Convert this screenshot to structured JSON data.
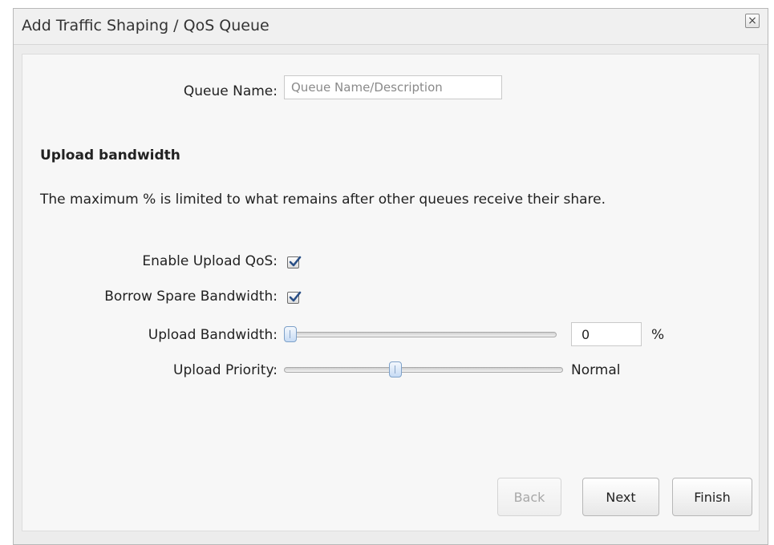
{
  "dialog": {
    "title": "Add Traffic Shaping / QoS Queue",
    "close_glyph": "×",
    "close_icon": "close-icon"
  },
  "queue": {
    "label": "Queue Name:",
    "value": "",
    "placeholder": "Queue Name/Description"
  },
  "upload": {
    "heading": "Upload bandwidth",
    "description": "The maximum % is limited to what remains after other queues receive their share.",
    "enable_qos_label": "Enable Upload QoS:",
    "enable_qos_checked": true,
    "borrow_label": "Borrow Spare Bandwidth:",
    "borrow_checked": true,
    "bandwidth_label": "Upload Bandwidth:",
    "bandwidth_value": "0",
    "bandwidth_unit": "%",
    "priority_label": "Upload Priority:",
    "priority_value": "Normal",
    "priority_level_fraction": 0.5
  },
  "buttons": {
    "back": "Back",
    "next": "Next",
    "finish": "Finish"
  },
  "colors": {
    "slider_handle": "#c6dbf4",
    "checkmark": "#2a4f86"
  }
}
